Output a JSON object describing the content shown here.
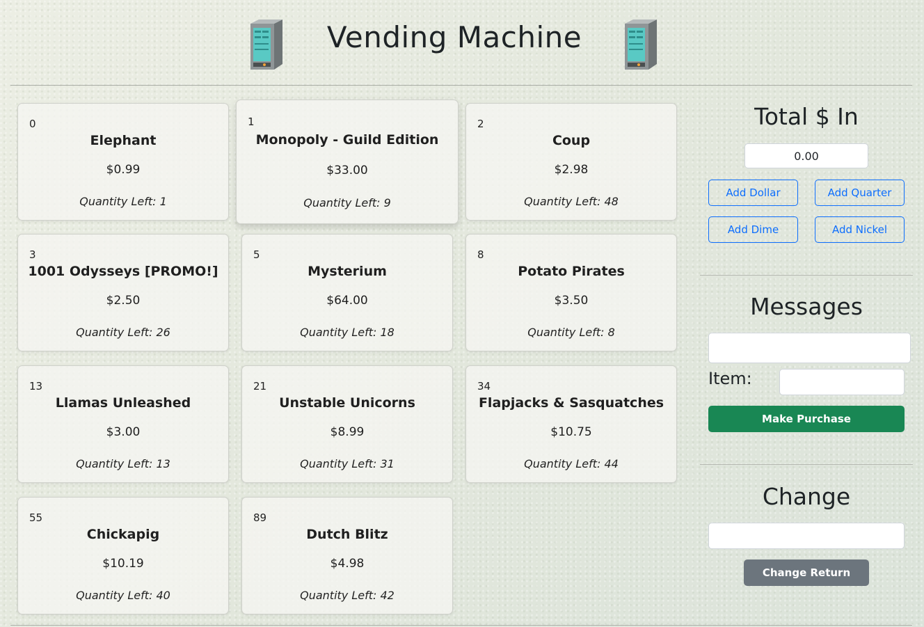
{
  "header": {
    "title": "Vending Machine",
    "icon_left": "vending-machine-icon",
    "icon_right": "vending-machine-icon"
  },
  "items": [
    {
      "id": "0",
      "name": "Elephant",
      "price": "$0.99",
      "quantity": "Quantity Left: 1"
    },
    {
      "id": "1",
      "name": "Monopoly - Guild Edition",
      "price": "$33.00",
      "quantity": "Quantity Left: 9"
    },
    {
      "id": "2",
      "name": "Coup",
      "price": "$2.98",
      "quantity": "Quantity Left: 48"
    },
    {
      "id": "3",
      "name": "1001 Odysseys [PROMO!]",
      "price": "$2.50",
      "quantity": "Quantity Left: 26"
    },
    {
      "id": "5",
      "name": "Mysterium",
      "price": "$64.00",
      "quantity": "Quantity Left: 18"
    },
    {
      "id": "8",
      "name": "Potato Pirates",
      "price": "$3.50",
      "quantity": "Quantity Left: 8"
    },
    {
      "id": "13",
      "name": "Llamas Unleashed",
      "price": "$3.00",
      "quantity": "Quantity Left: 13"
    },
    {
      "id": "21",
      "name": "Unstable Unicorns",
      "price": "$8.99",
      "quantity": "Quantity Left: 31"
    },
    {
      "id": "34",
      "name": "Flapjacks & Sasquatches",
      "price": "$10.75",
      "quantity": "Quantity Left: 44"
    },
    {
      "id": "55",
      "name": "Chickapig",
      "price": "$10.19",
      "quantity": "Quantity Left: 40"
    },
    {
      "id": "89",
      "name": "Dutch Blitz",
      "price": "$4.98",
      "quantity": "Quantity Left: 42"
    }
  ],
  "money": {
    "heading": "Total $ In",
    "total_value": "0.00",
    "add_dollar": "Add Dollar",
    "add_quarter": "Add Quarter",
    "add_dime": "Add Dime",
    "add_nickel": "Add Nickel"
  },
  "messages": {
    "heading": "Messages",
    "message_value": "",
    "item_label": "Item:",
    "item_value": "",
    "purchase_button": "Make Purchase"
  },
  "change": {
    "heading": "Change",
    "change_value": "",
    "return_button": "Change Return"
  },
  "colors": {
    "primary": "#0d6efd",
    "success": "#198754",
    "secondary": "#6c757d"
  }
}
